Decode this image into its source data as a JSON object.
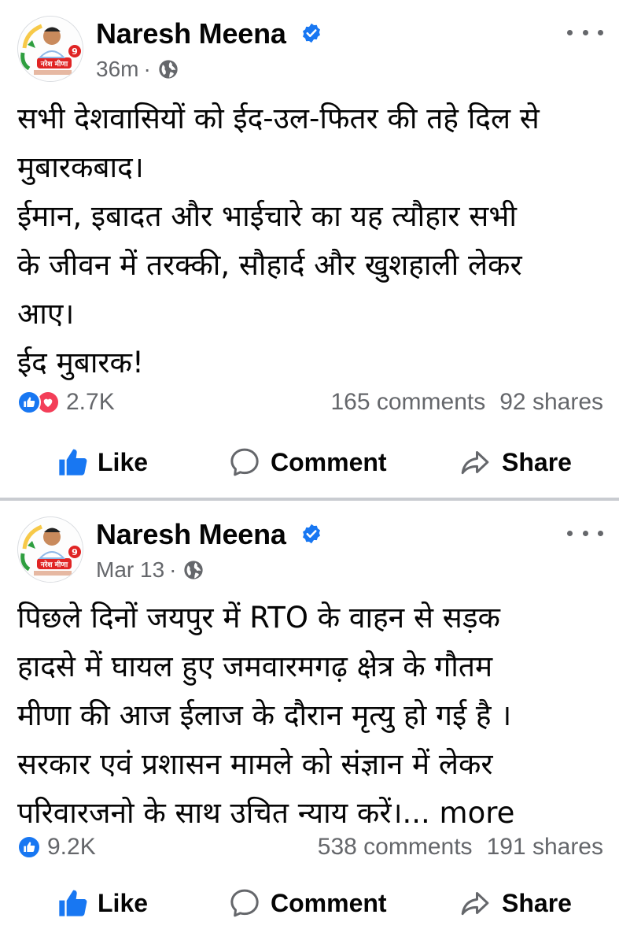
{
  "posts": [
    {
      "author": "Naresh Meena",
      "time": "36m",
      "separator": "·",
      "lines": [
        "सभी देशवासियों को ईद-उल-फितर की तहे दिल से",
        "मुबारकबाद।",
        "ईमान, इबादत और भाईचारे का यह त्यौहार सभी",
        "के जीवन में तरक्की, सौहार्द और खुशहाली लेकर",
        "आए।",
        "ईद मुबारक!"
      ],
      "more_label": "",
      "reaction_count": "2.7K",
      "comments": "165 comments",
      "shares": "92 shares",
      "reactions": [
        "like",
        "love"
      ]
    },
    {
      "author": "Naresh Meena",
      "time": "Mar 13",
      "separator": "·",
      "lines": [
        "पिछले दिनों जयपुर में RTO के वाहन से सड़क",
        "हादसे में घायल हुए जमवारमगढ़ क्षेत्र के गौतम",
        "मीणा की आज ईलाज के दौरान मृत्यु हो गई है ।",
        "सरकार एवं प्रशासन मामले को संज्ञान में लेकर",
        "परिवारजनो के साथ उचित न्याय करें।..."
      ],
      "more_label": " more",
      "reaction_count": "9.2K",
      "comments": "538 comments",
      "shares": "191 shares",
      "reactions": [
        "like"
      ]
    }
  ],
  "actions": {
    "like": "Like",
    "comment": "Comment",
    "share": "Share"
  },
  "avatar": {
    "text_top": "मुस्कान दिवस",
    "text_name": "नरेश मीणा",
    "badge": "9"
  },
  "colors": {
    "facebook_blue": "#1877f2",
    "love_red": "#f33e58",
    "secondary_text": "#65676b",
    "divider": "#c9ccd1"
  },
  "icons": {
    "verified": "verified-badge-icon",
    "globe": "globe-icon",
    "more": "more-dots-icon",
    "like": "thumbs-up-icon",
    "comment": "comment-bubble-icon",
    "share": "share-arrow-icon"
  }
}
